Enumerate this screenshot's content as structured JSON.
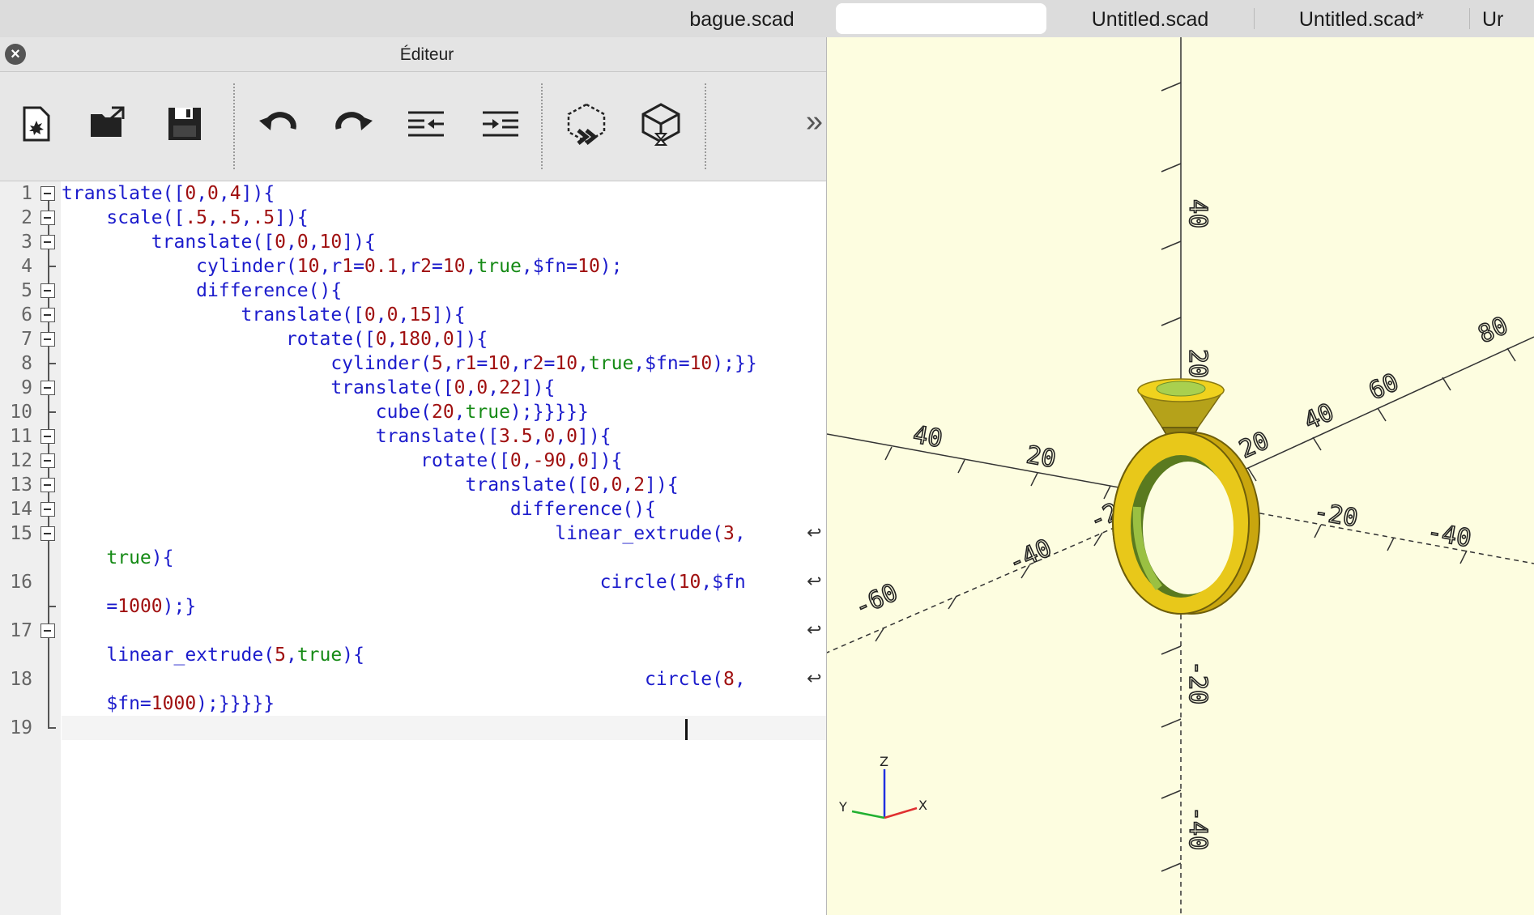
{
  "tabs": [
    {
      "label": "bague.scad",
      "active": false
    },
    {
      "label": "",
      "active": true
    },
    {
      "label": "Untitled.scad",
      "active": false
    },
    {
      "label": "Untitled.scad*",
      "active": false
    },
    {
      "label": "Ur",
      "active": false
    }
  ],
  "editor": {
    "title": "Éditeur",
    "toolbar": [
      {
        "name": "new-file-icon"
      },
      {
        "name": "open-file-icon"
      },
      {
        "name": "save-icon"
      },
      {
        "name": "undo-icon"
      },
      {
        "name": "redo-icon"
      },
      {
        "name": "unindent-icon"
      },
      {
        "name": "indent-icon"
      },
      {
        "name": "preview-icon"
      },
      {
        "name": "render-icon"
      }
    ],
    "line_numbers": [
      "1",
      "2",
      "3",
      "4",
      "5",
      "6",
      "7",
      "8",
      "9",
      "10",
      "11",
      "12",
      "13",
      "14",
      "15",
      "16",
      "17",
      "18",
      "19"
    ],
    "code": {
      "l1": "translate([0,0,4]){",
      "l2": "    scale([.5,.5,.5]){",
      "l3": "        translate([0,0,10]){",
      "l4": "            cylinder(10,r1=0.1,r2=10,true,$fn=10);",
      "l5": "            difference(){",
      "l6": "                translate([0,0,15]){",
      "l7": "                    rotate([0,180,0]){",
      "l8": "                        cylinder(5,r1=10,r2=10,true,$fn=10);}}",
      "l9": "                        translate([0,0,22]){",
      "l10": "                            cube(20,true);}}}}}",
      "l11": "                            translate([3.5,0,0]){",
      "l12": "                                rotate([0,-90,0]){",
      "l13": "                                    translate([0,0,2]){",
      "l14": "                                        difference(){",
      "l15a": "                                            linear_extrude(3,",
      "l15b": "    true){",
      "l16a": "                                                circle(10,$fn",
      "l16b": "    =1000);}",
      "l17b": "    linear_extrude(5,true){",
      "l18a": "                                                    circle(8,",
      "l18b": "    $fn=1000);}}}}}"
    }
  },
  "viewport": {
    "axis_z_labels": [
      "40",
      "20",
      "-20",
      "-40"
    ],
    "axis_x_labels": [
      "20",
      "40",
      "60",
      "80",
      "-20",
      "-40"
    ],
    "axis_y_labels": [
      "40",
      "20",
      "-20",
      "-40",
      "-60"
    ],
    "widget_labels": {
      "z": "Z",
      "x": "X",
      "y": "Y"
    },
    "colors": {
      "background": "#fdfde0",
      "model_yellow": "#e6c619",
      "model_green": "#8fbf3f",
      "axis_x": "#e02020",
      "axis_y": "#20b020",
      "axis_z": "#2020e0"
    }
  }
}
